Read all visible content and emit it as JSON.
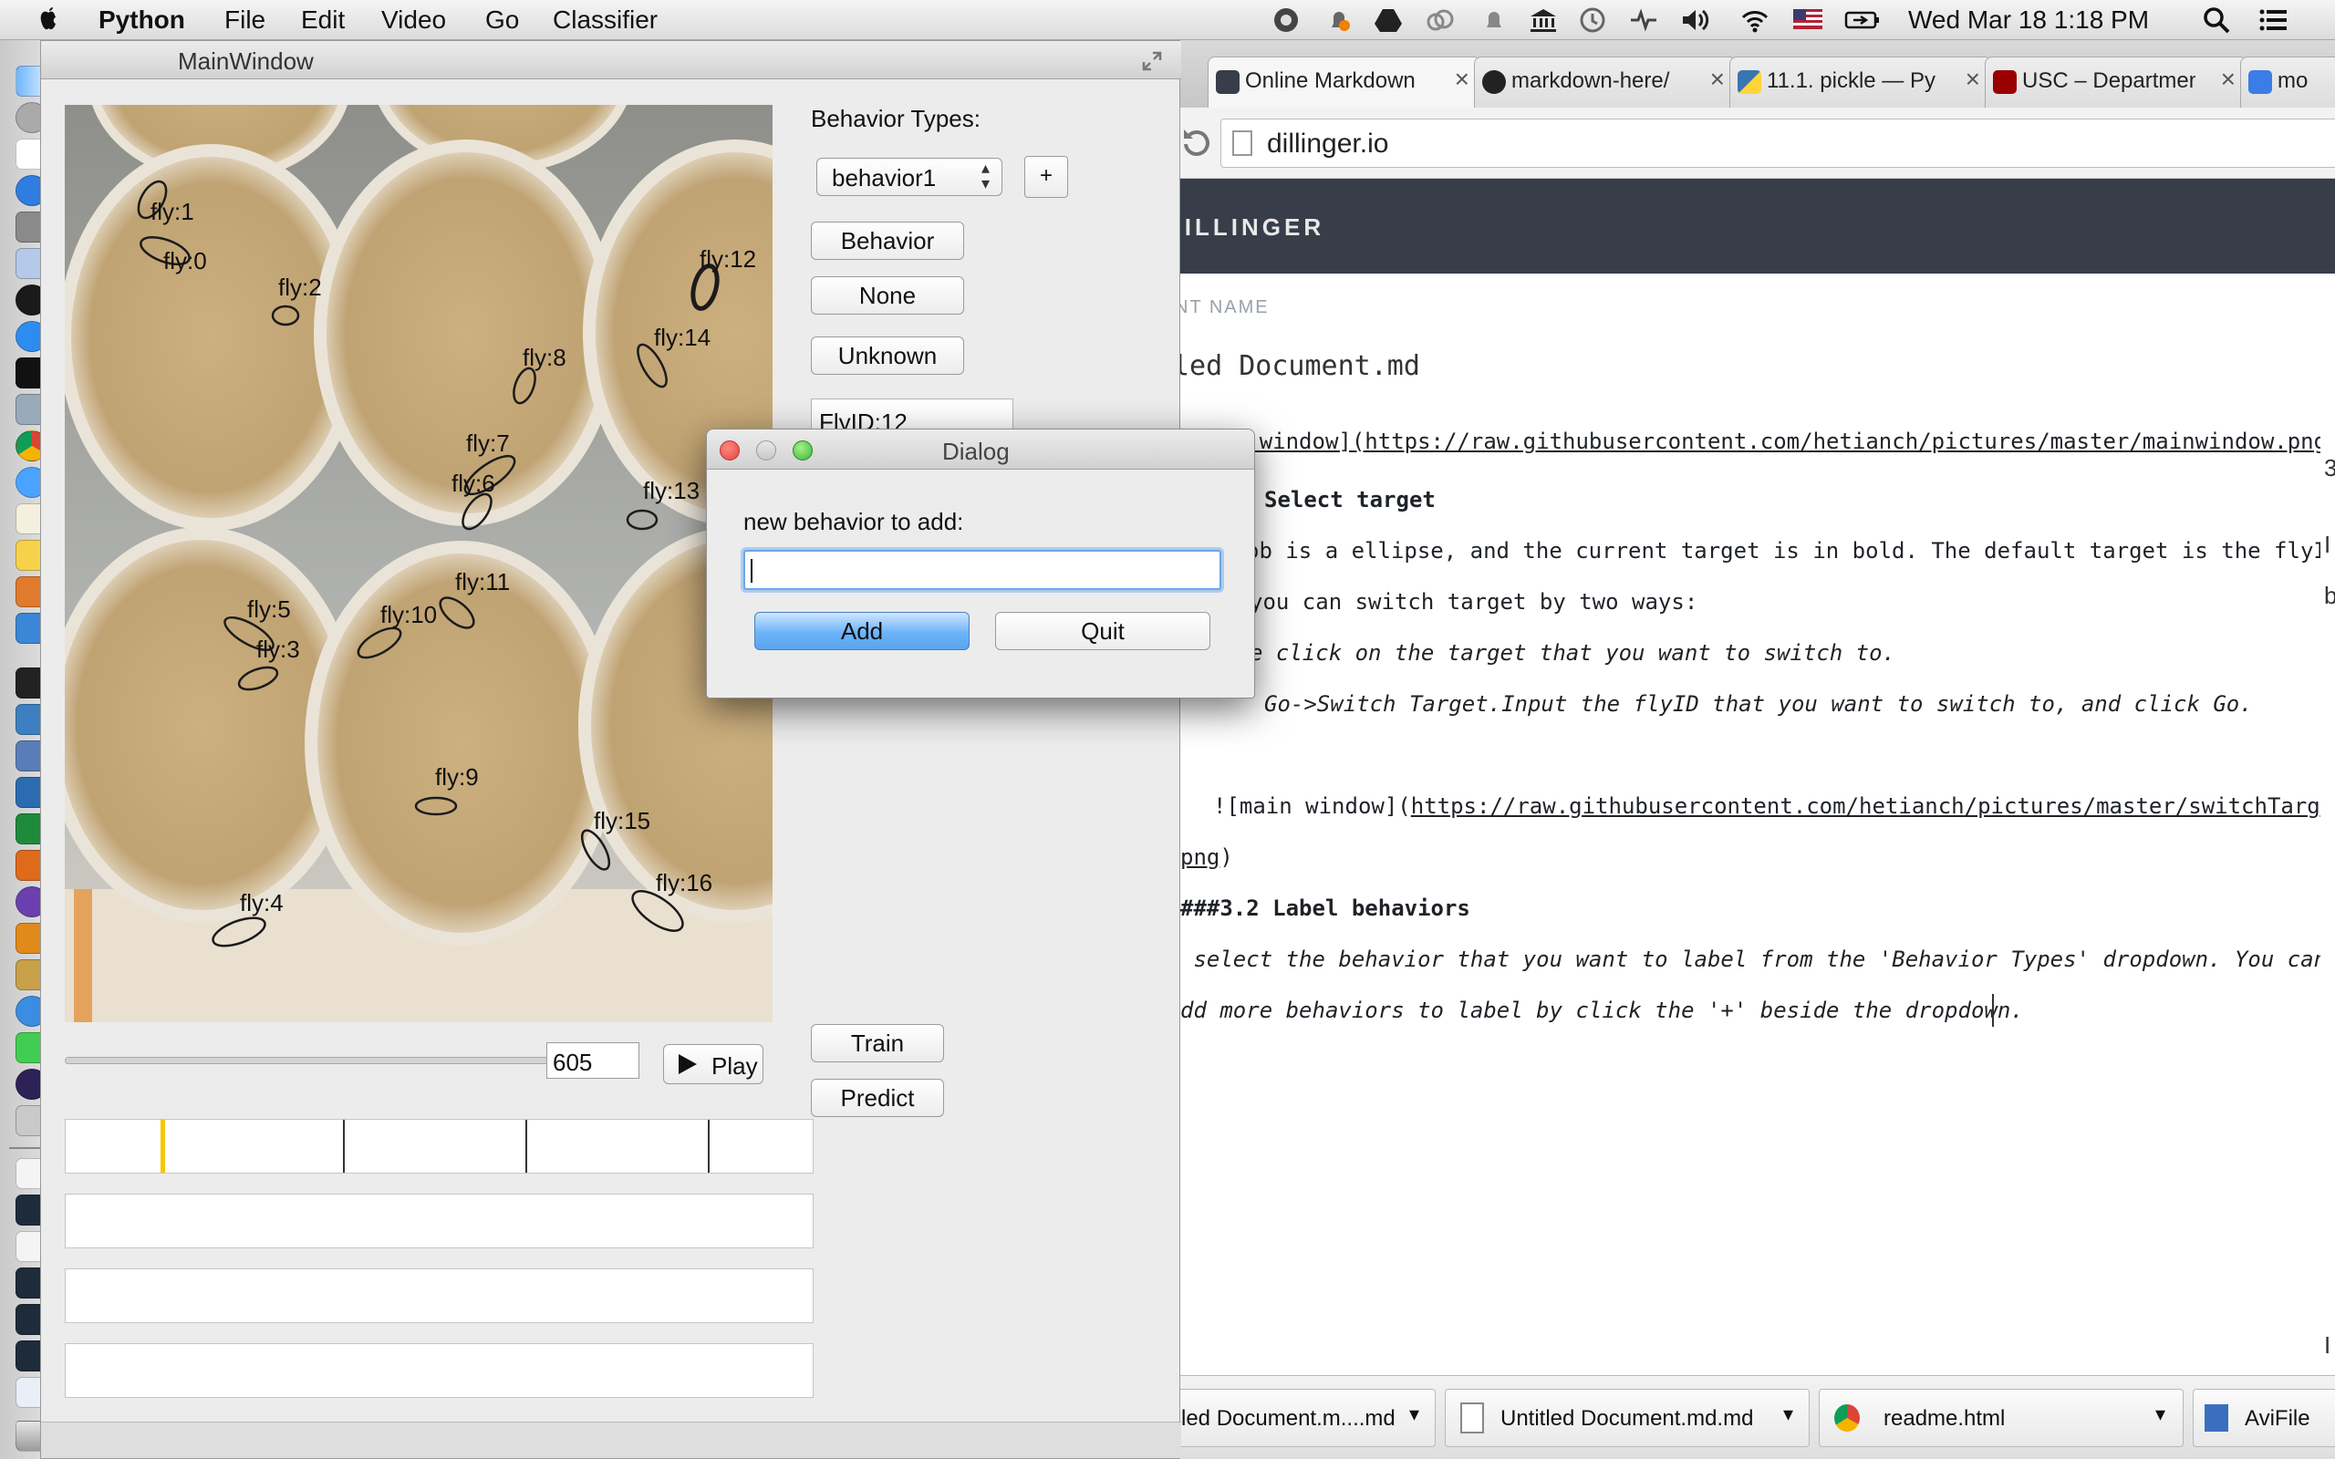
{
  "menubar": {
    "app": "Python",
    "items": [
      "File",
      "Edit",
      "Video",
      "Go",
      "Classifier"
    ],
    "clock": "Wed Mar 18  1:18 PM"
  },
  "main_window": {
    "title": "MainWindow",
    "fly_labels": [
      "fly:1",
      "fly:0",
      "fly:2",
      "fly:12",
      "fly:14",
      "fly:8",
      "fly:7",
      "fly:6",
      "fly:13",
      "fly:11",
      "fly:5",
      "fly:10",
      "fly:3",
      "fly:9",
      "fly:15",
      "fly:16",
      "fly:4"
    ],
    "selected_fly": "fly:12",
    "frame_value": "605",
    "play_label": "Play",
    "behavior_types_label": "Behavior Types:",
    "behavior_select_value": "behavior1",
    "add_behavior_label": "+",
    "behavior_button": "Behavior",
    "none_button": "None",
    "unknown_button": "Unknown",
    "flyid_text": "FlyID:12",
    "train_button": "Train",
    "predict_button": "Predict"
  },
  "dialog": {
    "title": "Dialog",
    "prompt": "new behavior to add:",
    "input_value": "",
    "add_button": "Add",
    "quit_button": "Quit"
  },
  "browser": {
    "tabs": [
      {
        "title": "Online Markdown",
        "icon": "dillinger-favicon"
      },
      {
        "title": "markdown-here/",
        "icon": "github-icon"
      },
      {
        "title": "11.1. pickle — Py",
        "icon": "python-icon"
      },
      {
        "title": "USC – Departmen",
        "icon": "usc-icon"
      },
      {
        "title": "mo",
        "icon": "google-icon"
      }
    ],
    "url": "dillinger.io",
    "header_brand": "DILLINGER",
    "doc_name_label": "NT NAME",
    "doc_name": "led Document.md",
    "editor_lines": {
      "l0": "[main window](https://raw.githubusercontent.com/hetianch/pictures/master/mainwindow.png)",
      "l1": "Select target",
      "l2": "ob is a ellipse, and the current target is in bold. The default target is the flyID",
      "l3": "you can switch target by two ways:",
      "l4": "e click on the target that you want to switch to.",
      "l5": "Go->Switch Target.Input the flyID that you want to switch to, and click Go.",
      "l6a": "![main window](",
      "l6b": "https://raw.githubusercontent.com/hetianch/pictures/master/switchTarget",
      "l7": "png",
      "l7b": ")",
      "l8": "###3.2 Label behaviors",
      "l9": " select the behavior that you want to label from the 'Behavior Types' dropdown. You can",
      "l10": "dd more behaviors to label by click the '+' beside the dropdown."
    },
    "right_edge": {
      "r1": "3",
      "r2": "I",
      "r3": "b",
      "r4": "I"
    },
    "downloads": [
      "led Document.m....md",
      "Untitled Document.md.md",
      "readme.html",
      "AviFile"
    ]
  },
  "colors": {
    "accent_button": "#6db3f8",
    "selection_yellow": "#f7c500",
    "dillinger_header": "#373d49"
  }
}
